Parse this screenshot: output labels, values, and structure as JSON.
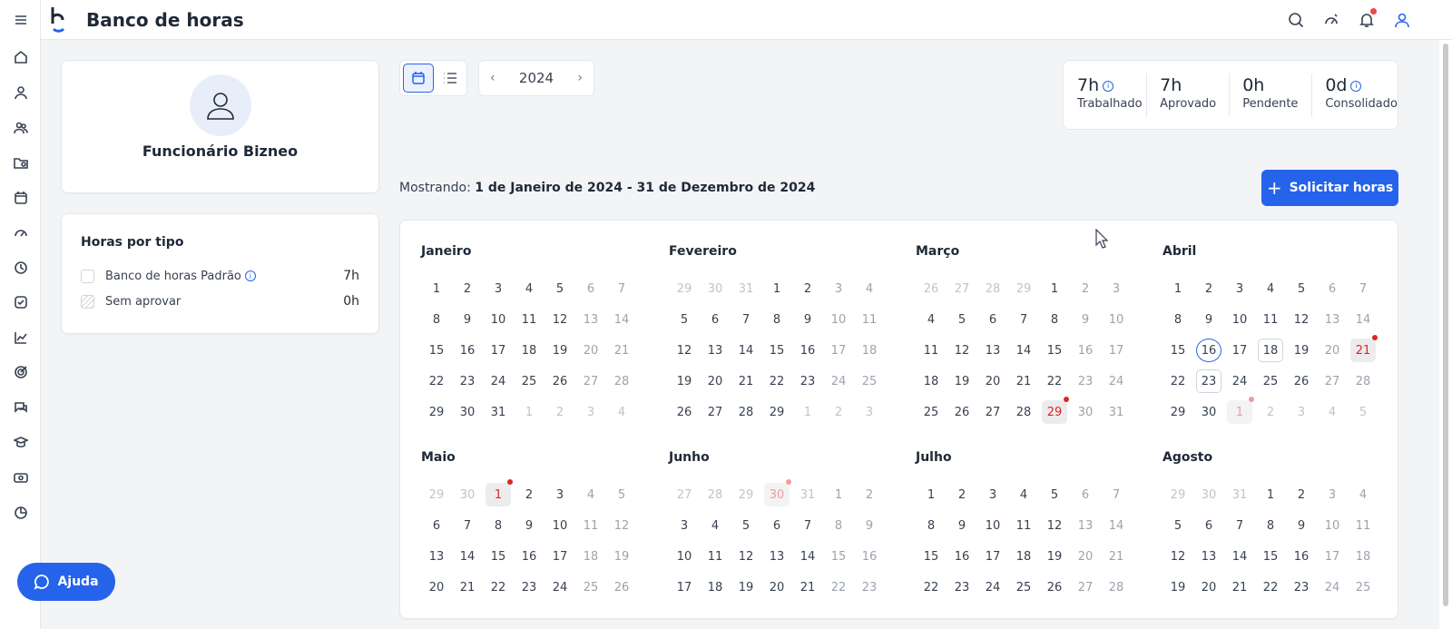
{
  "header": {
    "title": "Banco de horas",
    "icons": [
      "search-icon",
      "speedometer-icon",
      "bell-icon",
      "user-icon"
    ]
  },
  "sidebar": {
    "items": [
      "menu-icon",
      "home-icon",
      "user-icon",
      "users-icon",
      "folder-icon",
      "calendar-icon",
      "speedometer-icon",
      "clock-icon",
      "check-square-icon",
      "chart-icon",
      "target-icon",
      "chat-icon",
      "graduation-cap-icon",
      "money-icon",
      "pie-chart-icon"
    ]
  },
  "employee": {
    "name": "Funcionário Bizneo"
  },
  "hours_by_type": {
    "title": "Horas por tipo",
    "rows": [
      {
        "label": "Banco de horas Padrão",
        "value": "7h",
        "info": true
      },
      {
        "label": "Sem aprovar",
        "value": "0h",
        "info": false
      }
    ]
  },
  "toolbar": {
    "year": "2024",
    "prev": "‹",
    "next": "›"
  },
  "stats": [
    {
      "value": "7h",
      "label": "Trabalhado",
      "info": true
    },
    {
      "value": "7h",
      "label": "Aprovado",
      "info": false
    },
    {
      "value": "0h",
      "label": "Pendente",
      "info": false
    },
    {
      "value": "0d",
      "label": "Consolidado",
      "info": true
    }
  ],
  "range": {
    "prefix": "Mostrando:",
    "value": "1 de Janeiro de 2024 - 31 de Dezembro de 2024"
  },
  "request_button": {
    "label": "Solicitar horas"
  },
  "help_button": {
    "label": "Ajuda"
  },
  "calendar": {
    "months": [
      {
        "name": "Janeiro",
        "start": 0,
        "days": 31,
        "prev_days": 31,
        "rows": 5
      },
      {
        "name": "Fevereiro",
        "start": 3,
        "days": 29,
        "prev_days": 31,
        "rows": 5
      },
      {
        "name": "Março",
        "start": 4,
        "days": 31,
        "prev_days": 29,
        "rows": 5,
        "marks": {
          "29": "hol"
        }
      },
      {
        "name": "Abril",
        "start": 0,
        "days": 30,
        "prev_days": 31,
        "rows": 5,
        "marks": {
          "16": "sel",
          "18": "boxed",
          "21": "hol",
          "23": "boxed"
        },
        "next_marks": {
          "1": "holfade"
        }
      },
      {
        "name": "Maio",
        "start": 2,
        "days": 31,
        "prev_days": 30,
        "rows": 4,
        "marks": {
          "1": "hol"
        }
      },
      {
        "name": "Junho",
        "start": 5,
        "days": 30,
        "prev_days": 31,
        "rows": 4,
        "prev_marks": {
          "30": "holfade"
        }
      },
      {
        "name": "Julho",
        "start": 0,
        "days": 31,
        "prev_days": 30,
        "rows": 4
      },
      {
        "name": "Agosto",
        "start": 3,
        "days": 31,
        "prev_days": 31,
        "rows": 4
      }
    ]
  }
}
